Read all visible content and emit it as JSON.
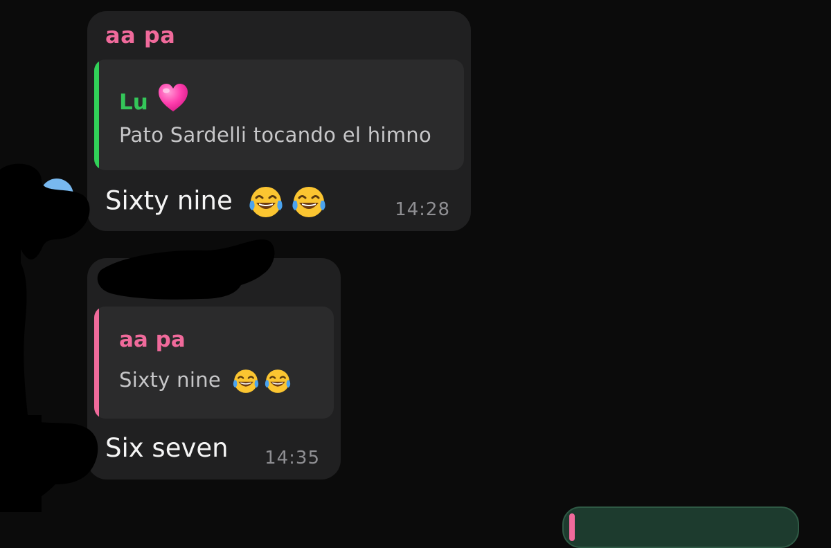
{
  "messages": [
    {
      "sender": "aa pa",
      "quote": {
        "author": "Lu",
        "text": "Pato Sardelli tocando el himno"
      },
      "text": "Sixty nine",
      "time": "14:28"
    },
    {
      "sender": "",
      "quote": {
        "author": "aa pa",
        "text": "Sixty nine"
      },
      "text": "Six seven",
      "time": "14:35"
    }
  ],
  "colors": {
    "background": "#0b0b0b",
    "bubble": "#202021",
    "quote_background": "#2b2b2c",
    "sender_pink": "#f06a9b",
    "quote_green": "#34c759",
    "timestamp": "#8f8f93"
  },
  "icons": {
    "tears_of_joy": "face-with-tears-of-joy-icon",
    "heart": "pink-heart-icon"
  }
}
